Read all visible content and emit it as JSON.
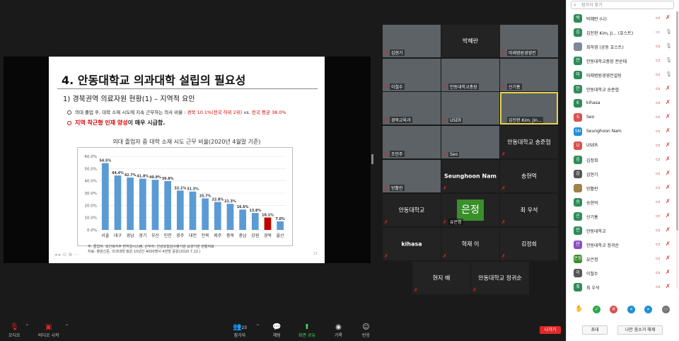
{
  "slide": {
    "title": "4. 안동대학교 의과대학 설립의 필요성",
    "subtitle": "1) 경북권역 의료자원 현황(1) – 지역적 요인",
    "bullet1_text": "의대 졸업 후, 대학 소재 시도에 지속 근무하는 의사 비율 : ",
    "bullet1_red": "경북 10.1%(전국 하위 2위)",
    "bullet1_vs": " vs. ",
    "bullet1_red2": "전국 평균 38.0%",
    "bullet2_red": "지역 착근형 인재 양성",
    "bullet2_text": "이 매우 시급함.",
    "source_line1": "주: 졸업자: 보건복지부 면허일시스템, 근무자: 건강보험심사평가원 요양기관 현황자료",
    "source_line2": "자료: 병원신문, 의과대학 정원 10년간 4000명서 4천명 증원(2020.7.22.)",
    "page_number": "12"
  },
  "chart_data": {
    "type": "bar",
    "title": "의대 졸업자 중 대학 소재 시도 근무 비율(2020년 4월말 기준)",
    "categories": [
      "서울",
      "대구",
      "경남",
      "경기",
      "부산",
      "인천",
      "광주",
      "대전",
      "전북",
      "제주",
      "충북",
      "충남",
      "강원",
      "경북",
      "울산"
    ],
    "values": [
      54.5,
      44.4,
      42.7,
      41.8,
      40.9,
      39.8,
      32.1,
      31.3,
      25.7,
      22.8,
      21.3,
      16.6,
      13.8,
      10.1,
      7.0
    ],
    "value_labels": [
      "54.5%",
      "44.4%",
      "42.7%",
      "41.8%",
      "40.9%",
      "39.8%",
      "32.1%",
      "31.3%",
      "25.7%",
      "22.8%",
      "21.3%",
      "16.6%",
      "13.8%",
      "10.1%",
      "7.0%"
    ],
    "highlight_index": 13,
    "ylim": [
      0,
      60
    ],
    "yticks": [
      "0.0%",
      "10.0%",
      "20.0%",
      "30.0%",
      "40.0%",
      "50.0%",
      "60.0%"
    ],
    "colors": {
      "bar": "#5b9bd5",
      "highlight": "#c00000"
    }
  },
  "tiles": [
    {
      "name": "김현기",
      "video": true,
      "muted": true
    },
    {
      "name": "박혜란",
      "video": false,
      "muted": false
    },
    {
      "name": "미래병원경영컨",
      "video": true,
      "muted": true
    },
    {
      "name": "이철수",
      "video": true,
      "muted": true
    },
    {
      "name": "안동대학교총장",
      "video": true,
      "muted": true
    },
    {
      "name": "신기홍",
      "video": true,
      "muted": true
    },
    {
      "name": "경북교육과",
      "video": true,
      "muted": true
    },
    {
      "name": "USER",
      "video": true,
      "muted": true
    },
    {
      "name": "김진현 Kim, Jin...",
      "video": true,
      "muted": false,
      "active": true
    },
    {
      "name": "조민주",
      "video": true,
      "muted": true
    },
    {
      "name": "Seo",
      "video": true,
      "muted": true
    },
    {
      "name": "안동대학교 송준협",
      "video": false,
      "muted": true
    },
    {
      "name": "방활란",
      "video": true,
      "muted": true
    },
    {
      "name": "Seunghoon Nam",
      "video": false,
      "muted": true
    },
    {
      "name": "송현억",
      "video": false,
      "muted": true
    },
    {
      "name": "안동대학교",
      "video": false,
      "muted": true
    },
    {
      "name": "유은정",
      "video": false,
      "muted": true,
      "avatar_text": "은정"
    },
    {
      "name": "최 우석",
      "video": false,
      "muted": true
    },
    {
      "name": "kihasa",
      "video": false,
      "muted": true
    },
    {
      "name": "혁재 이",
      "video": false,
      "muted": true
    },
    {
      "name": "김정희",
      "video": false,
      "muted": true
    },
    {
      "name": "현지 배",
      "video": false,
      "muted": true
    },
    {
      "name": "안동대학교 정귀순",
      "video": false,
      "muted": true
    }
  ],
  "toolbar": {
    "audio": "오디오",
    "video": "비디오 시작",
    "participants": "참가자",
    "participants_count": "23",
    "chat": "채팅",
    "share": "화면 공유",
    "record": "기록",
    "reactions": "반응",
    "leave": "나가기"
  },
  "panel": {
    "search_placeholder": "참가자 찾기",
    "participants": [
      {
        "initial": "박",
        "name": "박혜란 (나)",
        "color": "#2e8b57"
      },
      {
        "initial": "김",
        "name": "김진현 Kim, Ji... (호스트)",
        "color": "#2e8b57"
      },
      {
        "initial": "",
        "name": "최하영 (공동 호스트)",
        "color": "#7a8a99"
      },
      {
        "initial": "안",
        "name": "안동대학교총장 권순태",
        "color": "#2e8b57"
      },
      {
        "initial": "미",
        "name": "미래병원경영컨설팅",
        "color": "#2e8b57"
      },
      {
        "initial": "안",
        "name": "안동대학교 송준협",
        "color": "#2e8b57"
      },
      {
        "initial": "K",
        "name": "kihasa",
        "color": "#2e8b57"
      },
      {
        "initial": "S",
        "name": "Seo",
        "color": "#d9534f"
      },
      {
        "initial": "SN",
        "name": "Seunghoon Nam",
        "color": "#1f8fd6"
      },
      {
        "initial": "U",
        "name": "USER",
        "color": "#d9534f"
      },
      {
        "initial": "김",
        "name": "김정희",
        "color": "#2e8b57"
      },
      {
        "initial": "김",
        "name": "김현기",
        "color": "#555"
      },
      {
        "initial": "",
        "name": "방활란",
        "color": "#a0824a"
      },
      {
        "initial": "송",
        "name": "송현억",
        "color": "#2e8b57"
      },
      {
        "initial": "신",
        "name": "신기홍",
        "color": "#2e8b57"
      },
      {
        "initial": "안",
        "name": "안동대학교",
        "color": "#2e8b57"
      },
      {
        "initial": "안",
        "name": "안동대학교 정귀순",
        "color": "#8a4fbf"
      },
      {
        "initial": "은정",
        "name": "유은정",
        "color": "#3a8f2c"
      },
      {
        "initial": "이",
        "name": "이철수",
        "color": "#555"
      },
      {
        "initial": "최",
        "name": "최 우석",
        "color": "#2e8b57"
      }
    ],
    "invite": "초대",
    "unmute_me": "나만 음소거 해제"
  }
}
